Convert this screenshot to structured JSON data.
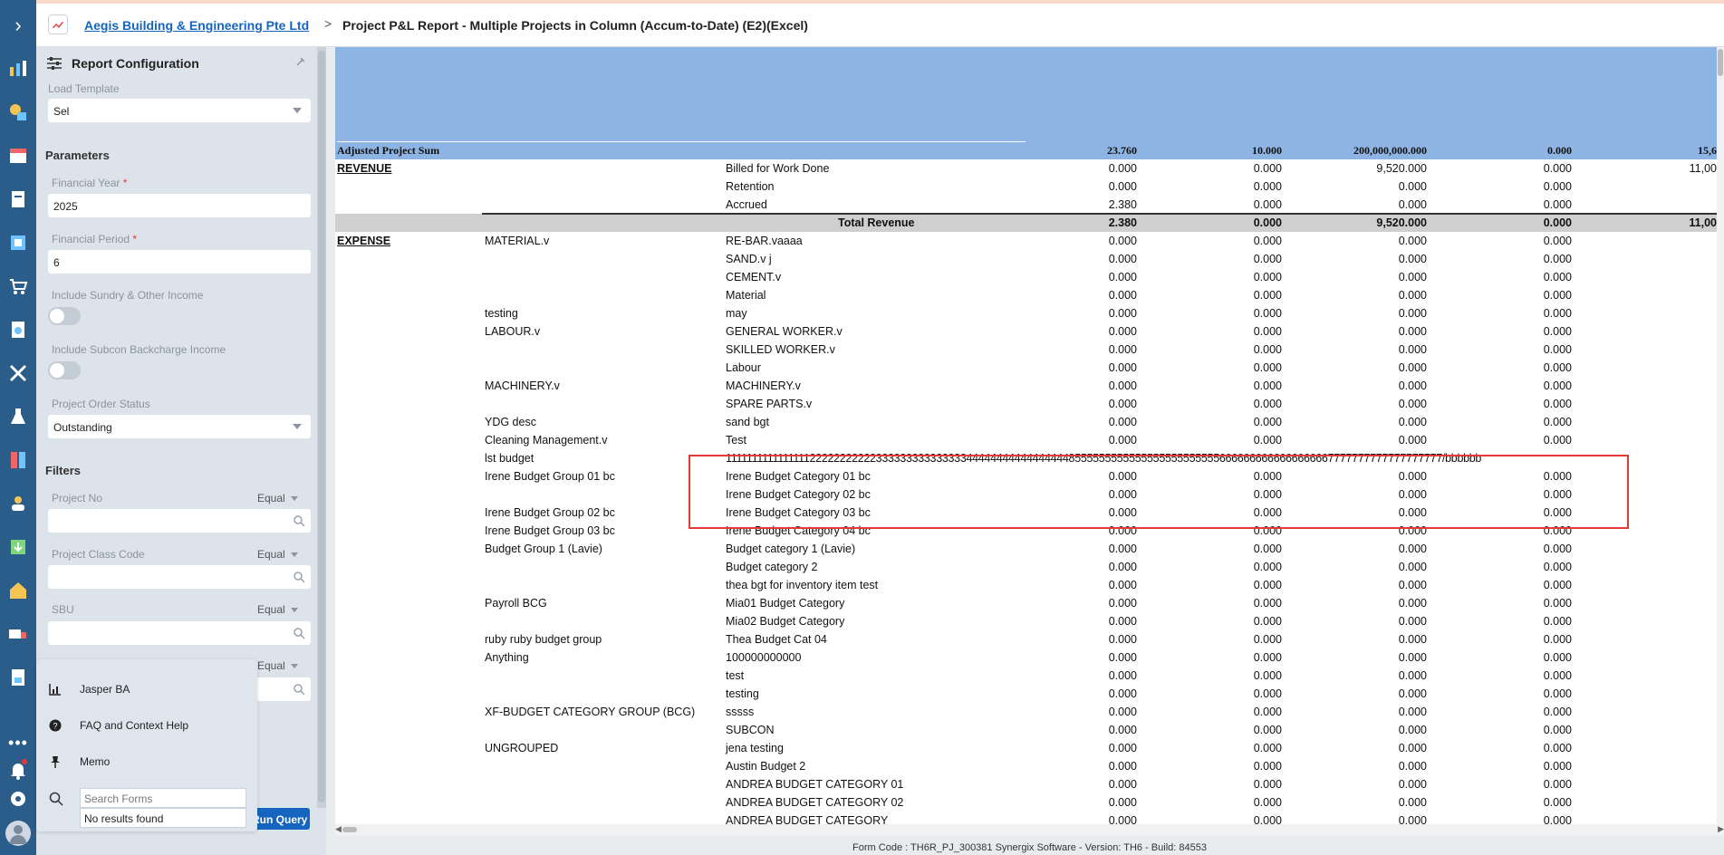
{
  "header": {
    "company": "Aegis Building & Engineering Pte Ltd",
    "separator": ">",
    "title": "Project P&L Report - Multiple Projects in Column (Accum-to-Date) (E2)(Excel)"
  },
  "config": {
    "title": "Report Configuration",
    "load_template_label": "Load Template",
    "load_template_value": "Sel",
    "parameters_label": "Parameters",
    "financial_year_label": "Financial Year",
    "financial_year_value": "2025",
    "financial_period_label": "Financial Period",
    "financial_period_value": "6",
    "required_mark": "*",
    "sundry_label": "Include Sundry & Other Income",
    "subcon_label": "Include Subcon Backcharge Income",
    "order_status_label": "Project Order Status",
    "order_status_value": "Outstanding",
    "filters_label": "Filters",
    "filters": [
      {
        "label": "Project No",
        "op": "Equal"
      },
      {
        "label": "Project Class Code",
        "op": "Equal"
      },
      {
        "label": "SBU",
        "op": "Equal"
      },
      {
        "label": "",
        "op": "Equal"
      }
    ],
    "run_button": "Run Query"
  },
  "popup": {
    "items": [
      "Jasper BA",
      "FAQ and Context Help",
      "Memo"
    ],
    "search_placeholder": "Search Forms",
    "no_results": "No results found"
  },
  "report": {
    "adjusted_label": "Adjusted Project Sum",
    "adjusted_values": [
      "23.760",
      "10.000",
      "200,000,000.000",
      "0.000",
      "15,6"
    ],
    "revenue_label": "REVENUE",
    "expense_label": "EXPENSE",
    "total_revenue_label": "Total Revenue",
    "total_revenue_values": [
      "2.380",
      "0.000",
      "9,520.000",
      "0.000",
      "11,00"
    ],
    "revenue_rows": [
      {
        "item": "Billed for Work Done",
        "values": [
          "0.000",
          "0.000",
          "9,520.000",
          "0.000",
          "11,00"
        ]
      },
      {
        "item": "Retention",
        "values": [
          "0.000",
          "0.000",
          "0.000",
          "0.000",
          ""
        ]
      },
      {
        "item": "Accrued",
        "values": [
          "2.380",
          "0.000",
          "0.000",
          "0.000",
          ""
        ]
      }
    ],
    "expense_rows": [
      {
        "group": "MATERIAL.v",
        "item": "RE-BAR.vaaaa",
        "values": [
          "0.000",
          "0.000",
          "0.000",
          "0.000"
        ]
      },
      {
        "group": "",
        "item": "SAND.v j",
        "values": [
          "0.000",
          "0.000",
          "0.000",
          "0.000"
        ]
      },
      {
        "group": "",
        "item": "CEMENT.v",
        "values": [
          "0.000",
          "0.000",
          "0.000",
          "0.000"
        ]
      },
      {
        "group": "",
        "item": "Material",
        "values": [
          "0.000",
          "0.000",
          "0.000",
          "0.000"
        ]
      },
      {
        "group": "testing",
        "item": "may",
        "values": [
          "0.000",
          "0.000",
          "0.000",
          "0.000"
        ]
      },
      {
        "group": "LABOUR.v",
        "item": "GENERAL WORKER.v",
        "values": [
          "0.000",
          "0.000",
          "0.000",
          "0.000"
        ]
      },
      {
        "group": "",
        "item": "SKILLED WORKER.v",
        "values": [
          "0.000",
          "0.000",
          "0.000",
          "0.000"
        ]
      },
      {
        "group": "",
        "item": "Labour",
        "values": [
          "0.000",
          "0.000",
          "0.000",
          "0.000"
        ]
      },
      {
        "group": "MACHINERY.v",
        "item": "MACHINERY.v",
        "values": [
          "0.000",
          "0.000",
          "0.000",
          "0.000"
        ]
      },
      {
        "group": "",
        "item": "SPARE PARTS.v",
        "values": [
          "0.000",
          "0.000",
          "0.000",
          "0.000"
        ]
      },
      {
        "group": "YDG desc",
        "item": "sand bgt",
        "values": [
          "0.000",
          "0.000",
          "0.000",
          "0.000"
        ]
      },
      {
        "group": "Cleaning Management.v",
        "item": "Test",
        "values": [
          "0.000",
          "0.000",
          "0.000",
          "0.000"
        ]
      },
      {
        "group": "lst budget",
        "item": "",
        "long": "1111111111111111222222222223333333333333334444444444444444485555555555555555555555556666666666666666667777777777777777777/bbbbbb",
        "values": [
          "",
          "",
          "",
          ""
        ]
      },
      {
        "group": "Irene Budget Group 01 bc",
        "item": "Irene Budget Category 01 bc",
        "values": [
          "0.000",
          "0.000",
          "0.000",
          "0.000"
        ]
      },
      {
        "group": "",
        "item": "Irene Budget Category 02 bc",
        "values": [
          "0.000",
          "0.000",
          "0.000",
          "0.000"
        ]
      },
      {
        "group": "Irene Budget Group 02 bc",
        "item": "Irene Budget Category 03 bc",
        "values": [
          "0.000",
          "0.000",
          "0.000",
          "0.000"
        ]
      },
      {
        "group": "Irene Budget Group 03 bc",
        "item": "Irene Budget Category 04 bc",
        "values": [
          "0.000",
          "0.000",
          "0.000",
          "0.000"
        ]
      },
      {
        "group": "Budget Group 1 (Lavie)",
        "item": "Budget category 1 (Lavie)",
        "values": [
          "0.000",
          "0.000",
          "0.000",
          "0.000"
        ]
      },
      {
        "group": "",
        "item": "Budget category 2",
        "values": [
          "0.000",
          "0.000",
          "0.000",
          "0.000"
        ]
      },
      {
        "group": "",
        "item": "thea bgt for inventory item test",
        "values": [
          "0.000",
          "0.000",
          "0.000",
          "0.000"
        ]
      },
      {
        "group": "Payroll BCG",
        "item": "Mia01 Budget Category",
        "values": [
          "0.000",
          "0.000",
          "0.000",
          "0.000"
        ]
      },
      {
        "group": "",
        "item": "Mia02 Budget Category",
        "values": [
          "0.000",
          "0.000",
          "0.000",
          "0.000"
        ]
      },
      {
        "group": "ruby ruby budget group",
        "item": "Thea Budget Cat 04",
        "values": [
          "0.000",
          "0.000",
          "0.000",
          "0.000"
        ]
      },
      {
        "group": "Anything",
        "item": "100000000000",
        "values": [
          "0.000",
          "0.000",
          "0.000",
          "0.000"
        ]
      },
      {
        "group": "",
        "item": "test",
        "values": [
          "0.000",
          "0.000",
          "0.000",
          "0.000"
        ]
      },
      {
        "group": "",
        "item": "testing",
        "values": [
          "0.000",
          "0.000",
          "0.000",
          "0.000"
        ]
      },
      {
        "group": "XF-BUDGET CATEGORY GROUP (BCG)",
        "item": "sssss",
        "values": [
          "0.000",
          "0.000",
          "0.000",
          "0.000"
        ]
      },
      {
        "group": "",
        "item": "SUBCON",
        "values": [
          "0.000",
          "0.000",
          "0.000",
          "0.000"
        ]
      },
      {
        "group": "UNGROUPED",
        "item": "jena testing",
        "values": [
          "0.000",
          "0.000",
          "0.000",
          "0.000"
        ]
      },
      {
        "group": "",
        "item": "Austin Budget 2",
        "values": [
          "0.000",
          "0.000",
          "0.000",
          "0.000"
        ]
      },
      {
        "group": "",
        "item": "ANDREA BUDGET CATEGORY 01",
        "values": [
          "0.000",
          "0.000",
          "0.000",
          "0.000"
        ]
      },
      {
        "group": "",
        "item": "ANDREA BUDGET CATEGORY 02",
        "values": [
          "0.000",
          "0.000",
          "0.000",
          "0.000"
        ]
      },
      {
        "group": "",
        "item": "ANDREA BUDGET CATEGORY",
        "values": [
          "0.000",
          "0.000",
          "0.000",
          "0.000"
        ]
      }
    ]
  },
  "footer": {
    "text": "Form Code : TH6R_PJ_300381    Synergix Software - Version: TH6 - Build: 84553"
  }
}
